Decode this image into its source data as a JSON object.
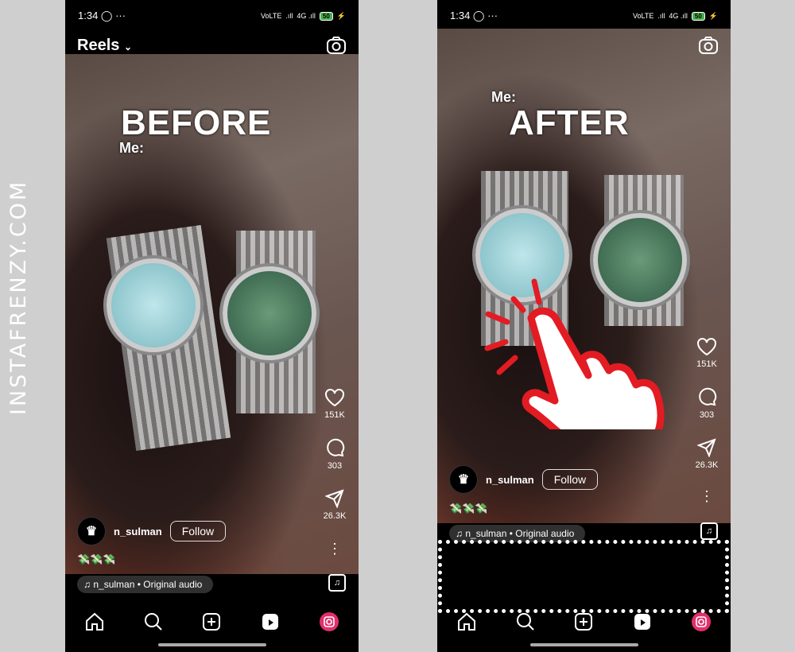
{
  "watermark": "INSTAFRENZY.COM",
  "colors": {
    "accent_red": "#e31b23",
    "background": "#cfcfcf"
  },
  "phones": [
    {
      "label": "BEFORE",
      "caption": "Me:",
      "status_time": "1:34",
      "battery": "50",
      "header_title": "Reels",
      "likes": "151K",
      "comments": "303",
      "shares": "26.3K",
      "username": "n_sulman",
      "follow_label": "Follow",
      "caption_emoji": "💸💸💸",
      "audio": "n_sulman • Original audio"
    },
    {
      "label": "AFTER",
      "caption": "Me:",
      "status_time": "1:34",
      "battery": "50",
      "likes": "151K",
      "comments": "303",
      "shares": "26.3K",
      "username": "n_sulman",
      "follow_label": "Follow",
      "caption_emoji": "💸💸💸",
      "audio": "n_sulman • Original audio"
    }
  ],
  "icons": {
    "status": [
      "whatsapp-icon",
      "more-icon",
      "volte-icon",
      "signal-icon",
      "battery-icon",
      "charging-icon"
    ],
    "nav": [
      "home-icon",
      "search-icon",
      "create-icon",
      "reels-icon",
      "profile-icon"
    ],
    "overlay": "tap-hand-icon"
  }
}
